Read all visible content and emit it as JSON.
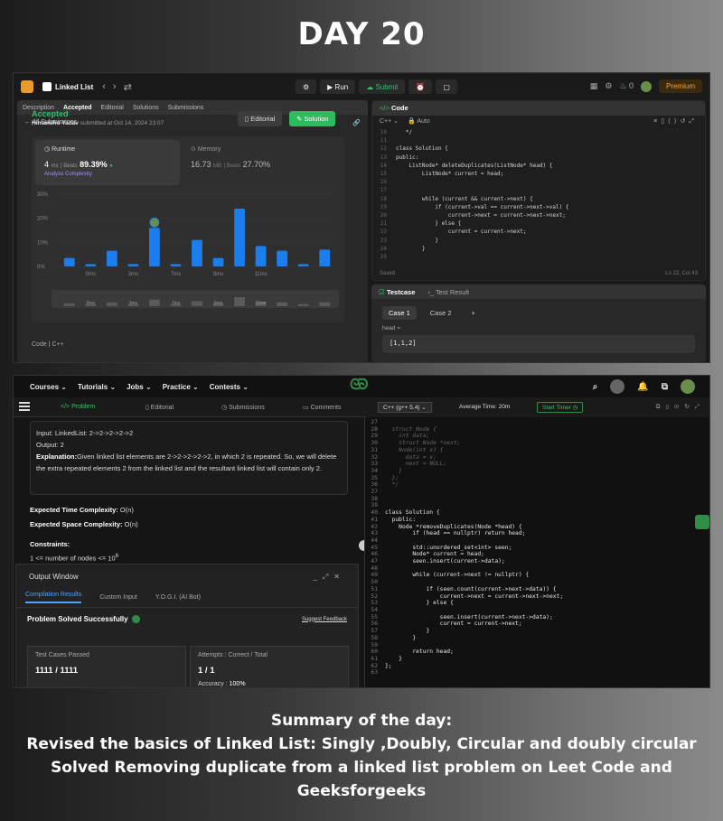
{
  "title": "DAY 20",
  "leetcode": {
    "problem_title": "Linked List",
    "run_label": "Run",
    "submit_label": "Submit",
    "streak": "0",
    "premium_label": "Premium",
    "tabs": [
      "Description",
      "Accepted",
      "Editorial",
      "Solutions",
      "Submissions"
    ],
    "all_submissions": "All Submissions",
    "status": "Accepted",
    "submitter": "Himanshu Yadav",
    "submitted_at": "submitted at Oct 14, 2024 23:07",
    "editorial_btn": "Editorial",
    "solution_btn": "Solution",
    "runtime_label": "Runtime",
    "runtime_value": "4",
    "runtime_unit": "ms",
    "runtime_beats_label": "Beats",
    "runtime_beats": "89.39%",
    "analyze_label": "Analyze Complexity",
    "memory_label": "Memory",
    "memory_value": "16.73",
    "memory_unit": "MB",
    "memory_beats_label": "Beats",
    "memory_beats": "27.70%",
    "code_lang_label": "Code | C++",
    "editor_title": "Code",
    "editor_lang": "C++",
    "editor_mode": "Auto",
    "saved": "Saved",
    "cursor": "Ln 22, Col 43",
    "code_lines": [
      {
        "n": "10",
        "t": "   */"
      },
      {
        "n": "11",
        "t": ""
      },
      {
        "n": "12",
        "t": "class Solution {"
      },
      {
        "n": "13",
        "t": "public:"
      },
      {
        "n": "14",
        "t": "    ListNode* deleteDuplicates(ListNode* head) {"
      },
      {
        "n": "15",
        "t": "        ListNode* current = head;"
      },
      {
        "n": "16",
        "t": ""
      },
      {
        "n": "17",
        "t": ""
      },
      {
        "n": "18",
        "t": "        while (current && current->next) {"
      },
      {
        "n": "19",
        "t": "            if (current->val == current->next->val) {"
      },
      {
        "n": "20",
        "t": "                current->next = current->next->next;"
      },
      {
        "n": "21",
        "t": "            } else {"
      },
      {
        "n": "22",
        "t": "                current = current->next;"
      },
      {
        "n": "23",
        "t": "            }"
      },
      {
        "n": "24",
        "t": "        }"
      },
      {
        "n": "25",
        "t": ""
      }
    ],
    "testcase_label": "Testcase",
    "test_result_label": "Test Result",
    "case1": "Case 1",
    "case2": "Case 2",
    "input_label": "head =",
    "input_value": "[1,1,2]"
  },
  "chart_data": {
    "type": "bar",
    "title": "",
    "ylabel": "",
    "yticks": [
      "30%",
      "20%",
      "10%",
      "0%"
    ],
    "xticks": [
      "0ms",
      "3ms",
      "7ms",
      "9ms",
      "11ms"
    ],
    "ylim": [
      0,
      30
    ],
    "values": [
      3.5,
      1,
      6.5,
      1,
      16,
      1,
      11,
      3.5,
      24,
      8.5,
      6.5,
      1,
      7
    ],
    "highlight_index": 4,
    "color": "#1a7ef0",
    "mini_ticks": [
      "0ms",
      "3ms",
      "7ms",
      "9ms",
      "11ms"
    ]
  },
  "gfg": {
    "nav": [
      "Courses",
      "Tutorials",
      "Jobs",
      "Practice",
      "Contests"
    ],
    "tabs": [
      "Problem",
      "Editorial",
      "Submissions",
      "Comments"
    ],
    "input_line": "Input: LinkedList: 2->2->2->2->2",
    "output_line": "Output: 2",
    "explanation_label": "Explanation:",
    "explanation": "Given linked list elements are 2->2->2->2->2, in which 2 is repeated. So, we will delete the extra repeated elements 2 from the linked list and the resultant linked list will contain only 2.",
    "time_label": "Expected Time Complexity:",
    "time_value": "O(n)",
    "space_label": "Expected Space Complexity:",
    "space_value": "O(n)",
    "constraints_label": "Constraints:",
    "constraint": "1 <= number of nodes <= 10",
    "constraint_exp": "6",
    "output_window": "Output Window",
    "ow_tabs": [
      "Compilation Results",
      "Custom Input",
      "Y.O.G.I. (AI Bot)"
    ],
    "solved": "Problem Solved Successfully",
    "feedback": "Suggest Feedback",
    "tc_label": "Test Cases Passed",
    "tc_value": "1111 / 1111",
    "att_label": "Attempts : Correct / Total",
    "att_value": "1 / 1",
    "acc_label": "Accuracy :",
    "acc_value": "100%",
    "lang": "C++ (g++ 5.4)",
    "avg_time": "Average Time: 20m",
    "start_timer": "Start Timer",
    "code": [
      {
        "n": "27",
        "t": "",
        "cm": true
      },
      {
        "n": "28",
        "t": "  struct Node {",
        "cm": true
      },
      {
        "n": "29",
        "t": "    int data;",
        "cm": true
      },
      {
        "n": "30",
        "t": "    struct Node *next;",
        "cm": true
      },
      {
        "n": "31",
        "t": "    Node(int x) {",
        "cm": true
      },
      {
        "n": "32",
        "t": "      data = x;",
        "cm": true
      },
      {
        "n": "33",
        "t": "      next = NULL;",
        "cm": true
      },
      {
        "n": "34",
        "t": "    }",
        "cm": true
      },
      {
        "n": "35",
        "t": "  };",
        "cm": true
      },
      {
        "n": "36",
        "t": "  */",
        "cm": true
      },
      {
        "n": "37",
        "t": "",
        "cm": false
      },
      {
        "n": "38",
        "t": "",
        "cm": false
      },
      {
        "n": "39",
        "t": "",
        "cm": false
      },
      {
        "n": "40",
        "t": "class Solution {",
        "cm": false
      },
      {
        "n": "41",
        "t": "  public:",
        "cm": false
      },
      {
        "n": "42",
        "t": "    Node *removeDuplicates(Node *head) {",
        "cm": false
      },
      {
        "n": "43",
        "t": "        if (head == nullptr) return head;",
        "cm": false
      },
      {
        "n": "44",
        "t": "",
        "cm": false
      },
      {
        "n": "45",
        "t": "        std::unordered_set<int> seen;",
        "cm": false
      },
      {
        "n": "46",
        "t": "        Node* current = head;",
        "cm": false
      },
      {
        "n": "47",
        "t": "        seen.insert(current->data);",
        "cm": false
      },
      {
        "n": "48",
        "t": "",
        "cm": false
      },
      {
        "n": "49",
        "t": "        while (current->next != nullptr) {",
        "cm": false
      },
      {
        "n": "50",
        "t": "",
        "cm": false
      },
      {
        "n": "51",
        "t": "            if (seen.count(current->next->data)) {",
        "cm": false
      },
      {
        "n": "52",
        "t": "                current->next = current->next->next;",
        "cm": false
      },
      {
        "n": "53",
        "t": "            } else {",
        "cm": false
      },
      {
        "n": "54",
        "t": "",
        "cm": false
      },
      {
        "n": "55",
        "t": "                seen.insert(current->next->data);",
        "cm": false
      },
      {
        "n": "56",
        "t": "                current = current->next;",
        "cm": false
      },
      {
        "n": "57",
        "t": "            }",
        "cm": false
      },
      {
        "n": "58",
        "t": "        }",
        "cm": false
      },
      {
        "n": "59",
        "t": "",
        "cm": false
      },
      {
        "n": "60",
        "t": "        return head;",
        "cm": false
      },
      {
        "n": "61",
        "t": "    }",
        "cm": false
      },
      {
        "n": "62",
        "t": "};",
        "cm": false
      },
      {
        "n": "63",
        "t": "",
        "cm": false
      }
    ]
  },
  "summary": {
    "line1": "Summary of the day:",
    "line2": "Revised the basics of Linked List: Singly ,Doubly, Circular and doubly circular",
    "line3": "Solved Removing duplicate from a linked list problem on  Leet Code and Geeksforgeeks"
  }
}
